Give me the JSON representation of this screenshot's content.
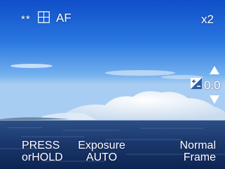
{
  "viewfinder": {
    "top_left": {
      "flash_indicator": "**",
      "grid_icon": "grid-icon",
      "focus_mode": "AF"
    },
    "top_right": {
      "zoom": "x2"
    },
    "exposure_control": {
      "icon": "exposure-compensation-icon",
      "value": "0.0",
      "up_icon": "triangle-up-icon",
      "down_icon": "triangle-down-icon"
    },
    "softkeys": {
      "left": {
        "line1": "PRESS",
        "line2": "orHOLD"
      },
      "middle": {
        "line1": "Exposure",
        "line2": "AUTO"
      },
      "right": {
        "line1": "Normal",
        "line2": "Frame"
      }
    }
  }
}
